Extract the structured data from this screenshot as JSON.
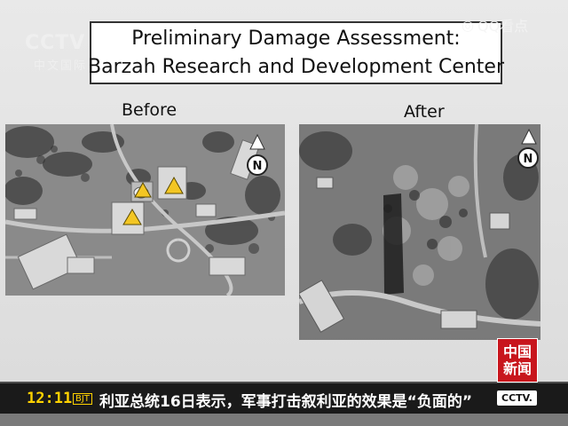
{
  "slide": {
    "title_line1": "Preliminary Damage Assessment:",
    "title_line2": "Barzah Research and Development Center",
    "label_before": "Before",
    "label_after": "After",
    "north_marker": "N"
  },
  "overlay": {
    "channel_logo": "CCTV",
    "channel_sub": "中文国际",
    "watermark": "QQ看点"
  },
  "news_badge": {
    "line1": "中国",
    "line2": "新闻"
  },
  "ticker": {
    "time": "12:11",
    "timezone": "BJT",
    "headline": "利亚总统16日表示，军事打击叙利亚的效果是“负面的”",
    "logo": "CCTV."
  },
  "colors": {
    "ticker_yellow": "#ffd200",
    "badge_red": "#c8161d",
    "warning_yellow": "#f3c623"
  }
}
